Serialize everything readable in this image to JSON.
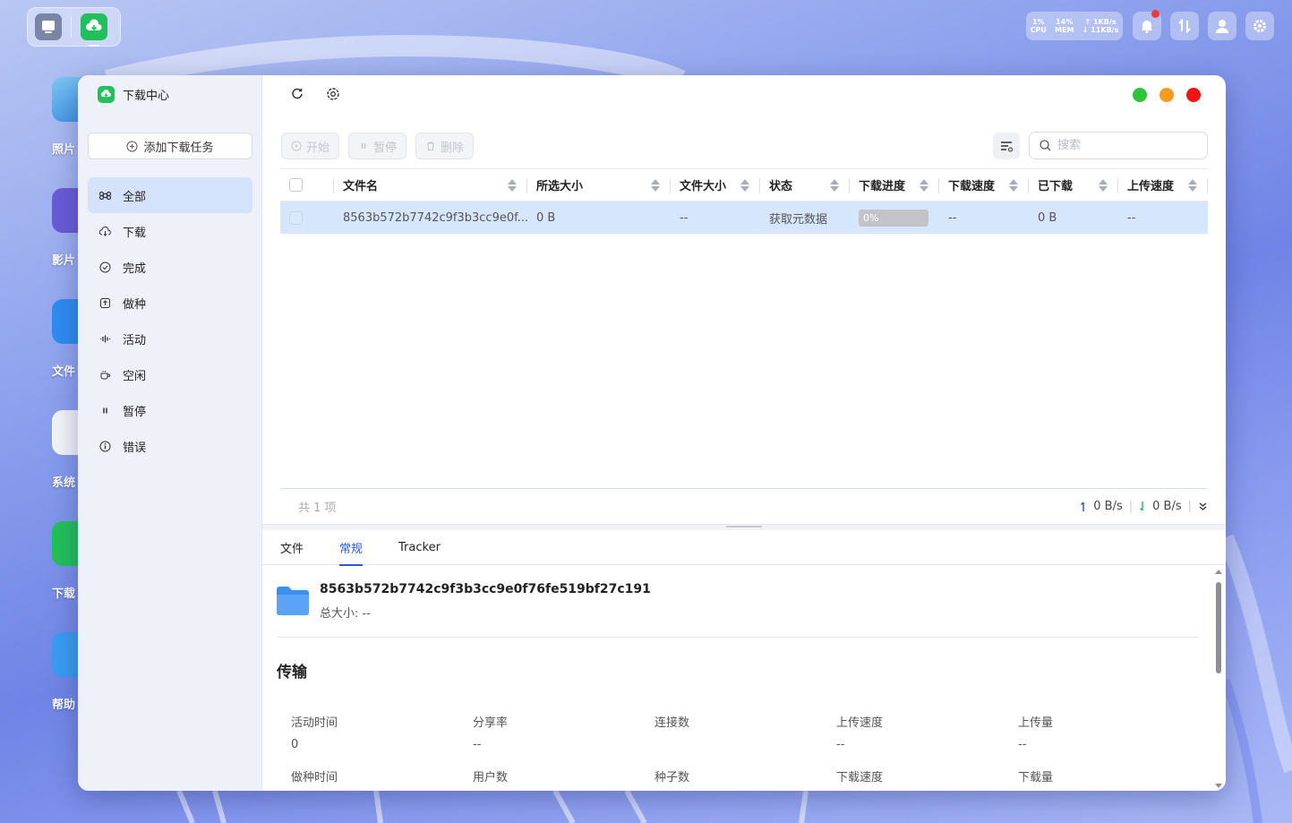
{
  "desktop": {
    "icons": [
      {
        "label": "照片",
        "color": "#5aa8e8"
      },
      {
        "label": "影片",
        "color": "#6a5bd8"
      },
      {
        "label": "文件",
        "color": "#2f8cf0"
      },
      {
        "label": "系统",
        "color": "#f2f4f8"
      },
      {
        "label": "下载",
        "color": "#22c05a"
      },
      {
        "label": "帮助",
        "color": "#3a9cf0"
      }
    ]
  },
  "status": {
    "cpu_value": "1%",
    "cpu_label": "CPU",
    "mem_value": "14%",
    "mem_label": "MEM",
    "up_speed": "↑ 1KB/s",
    "down_speed": "↓ 11KB/s"
  },
  "window": {
    "app_title": "下载中心",
    "add_task": "添加下载任务",
    "nav": [
      {
        "label": "全部",
        "icon": "command-icon"
      },
      {
        "label": "下载",
        "icon": "cloud-download-icon"
      },
      {
        "label": "完成",
        "icon": "check-circle-icon"
      },
      {
        "label": "做种",
        "icon": "upload-box-icon"
      },
      {
        "label": "活动",
        "icon": "activity-wave-icon"
      },
      {
        "label": "空闲",
        "icon": "cup-icon"
      },
      {
        "label": "暂停",
        "icon": "pause-icon"
      },
      {
        "label": "错误",
        "icon": "info-circle-icon"
      }
    ],
    "actions": {
      "start": "开始",
      "pause": "暂停",
      "delete": "删除"
    },
    "search_placeholder": "搜索",
    "columns": [
      "文件名",
      "所选大小",
      "文件大小",
      "状态",
      "下载进度",
      "下载速度",
      "已下载",
      "上传速度"
    ],
    "rows": [
      {
        "name": "8563b572b7742c9f3b3cc9e0f...",
        "selected_size": "0 B",
        "file_size": "--",
        "status": "获取元数据",
        "progress": "0%",
        "progress_value": 0,
        "down_speed": "--",
        "downloaded": "0 B",
        "up_speed": "--"
      }
    ],
    "footer": {
      "count": "共 1 项",
      "up_rate": "0 B/s",
      "down_rate": "0 B/s"
    },
    "tabs": [
      "文件",
      "常规",
      "Tracker"
    ],
    "active_tab": "常规",
    "detail": {
      "name": "8563b572b7742c9f3b3cc9e0f76fe519bf27c191",
      "total_size": "总大小: --",
      "section_title": "传输",
      "stats": [
        {
          "key": "活动时间",
          "value": "0"
        },
        {
          "key": "分享率",
          "value": "--"
        },
        {
          "key": "连接数",
          "value": ""
        },
        {
          "key": "上传速度",
          "value": "--"
        },
        {
          "key": "上传量",
          "value": "--"
        },
        {
          "key": "做种时间",
          "value": ""
        },
        {
          "key": "用户数",
          "value": ""
        },
        {
          "key": "种子数",
          "value": ""
        },
        {
          "key": "下载速度",
          "value": ""
        },
        {
          "key": "下载量",
          "value": ""
        }
      ]
    }
  },
  "colors": {
    "accent": "#2f5ad6",
    "selected_row": "#d6e6fd",
    "green": "#22c05a",
    "win_green": "#2ec43a",
    "win_orange": "#f79a1f",
    "win_red": "#f01414"
  }
}
